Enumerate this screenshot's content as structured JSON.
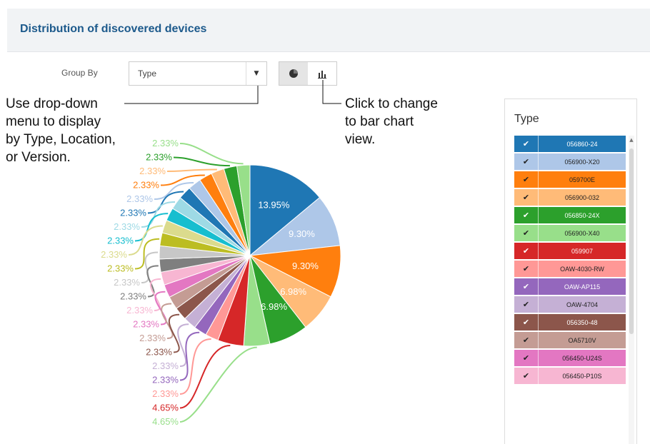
{
  "panel": {
    "title": "Distribution of discovered devices"
  },
  "controls": {
    "group_by_label": "Group By",
    "group_by_value": "Type",
    "pie_icon": "pie-chart-icon",
    "bar_icon": "bar-chart-icon"
  },
  "callouts": {
    "dropdown": [
      "Use drop-down",
      "menu to display",
      "by Type, Location,",
      "or Version."
    ],
    "toggle": [
      "Click to change",
      "to bar chart",
      "view."
    ]
  },
  "legend": {
    "title": "Type",
    "items": [
      {
        "label": "056860-24",
        "color": "#1f77b4",
        "text": "#ffffff"
      },
      {
        "label": "056900-X20",
        "color": "#aec7e8",
        "text": "#222222"
      },
      {
        "label": "059700E",
        "color": "#ff7f0e",
        "text": "#222222"
      },
      {
        "label": "056900-032",
        "color": "#ffbb78",
        "text": "#222222"
      },
      {
        "label": "056850-24X",
        "color": "#2ca02c",
        "text": "#ffffff"
      },
      {
        "label": "056900-X40",
        "color": "#98df8a",
        "text": "#222222"
      },
      {
        "label": "059907",
        "color": "#d62728",
        "text": "#ffffff"
      },
      {
        "label": "OAW-4030-RW",
        "color": "#ff9896",
        "text": "#222222"
      },
      {
        "label": "OAW-AP115",
        "color": "#9467bd",
        "text": "#ffffff"
      },
      {
        "label": "OAW-4704",
        "color": "#c5b0d5",
        "text": "#222222"
      },
      {
        "label": "056350-48",
        "color": "#8c564b",
        "text": "#ffffff"
      },
      {
        "label": "OA5710V",
        "color": "#c49c94",
        "text": "#222222"
      },
      {
        "label": "056450-U24S",
        "color": "#e377c2",
        "text": "#222222"
      },
      {
        "label": "056450-P10S",
        "color": "#f7b6d2",
        "text": "#222222"
      }
    ]
  },
  "chart_data": {
    "type": "pie",
    "title": "Distribution of discovered devices",
    "unit": "%",
    "slices": [
      {
        "label": "056860-24",
        "value": 13.95,
        "color": "#1f77b4"
      },
      {
        "label": "056900-X20",
        "value": 9.3,
        "color": "#aec7e8"
      },
      {
        "label": "059700E",
        "value": 9.3,
        "color": "#ff7f0e"
      },
      {
        "label": "056900-032",
        "value": 6.98,
        "color": "#ffbb78"
      },
      {
        "label": "056850-24X",
        "value": 6.98,
        "color": "#2ca02c"
      },
      {
        "label": "056900-X40",
        "value": 4.65,
        "color": "#98df8a"
      },
      {
        "label": "059907",
        "value": 4.65,
        "color": "#d62728"
      },
      {
        "label": "OAW-4030-RW",
        "value": 2.33,
        "color": "#ff9896"
      },
      {
        "label": "OAW-AP115",
        "value": 2.33,
        "color": "#9467bd"
      },
      {
        "label": "OAW-4704",
        "value": 2.33,
        "color": "#c5b0d5"
      },
      {
        "label": "056350-48",
        "value": 2.33,
        "color": "#8c564b"
      },
      {
        "label": "OA5710V",
        "value": 2.33,
        "color": "#c49c94"
      },
      {
        "label": "056450-U24S",
        "value": 2.33,
        "color": "#e377c2"
      },
      {
        "label": "056450-P10S",
        "value": 2.33,
        "color": "#f7b6d2"
      },
      {
        "label": "",
        "value": 2.33,
        "color": "#7f7f7f"
      },
      {
        "label": "",
        "value": 2.33,
        "color": "#c7c7c7"
      },
      {
        "label": "",
        "value": 2.33,
        "color": "#bcbd22"
      },
      {
        "label": "",
        "value": 2.33,
        "color": "#dbdb8d"
      },
      {
        "label": "",
        "value": 2.33,
        "color": "#17becf"
      },
      {
        "label": "",
        "value": 2.33,
        "color": "#9edae5"
      },
      {
        "label": "",
        "value": 2.33,
        "color": "#1f77b4"
      },
      {
        "label": "",
        "value": 2.33,
        "color": "#aec7e8"
      },
      {
        "label": "",
        "value": 2.33,
        "color": "#ff7f0e"
      },
      {
        "label": "",
        "value": 2.33,
        "color": "#ffbb78"
      },
      {
        "label": "",
        "value": 2.33,
        "color": "#2ca02c"
      },
      {
        "label": "",
        "value": 2.33,
        "color": "#98df8a"
      }
    ],
    "data_labels": [
      "13.95%",
      "9.30%",
      "9.30%",
      "6.98%",
      "6.98%",
      "4.65%",
      "4.65%",
      "2.33%"
    ]
  }
}
